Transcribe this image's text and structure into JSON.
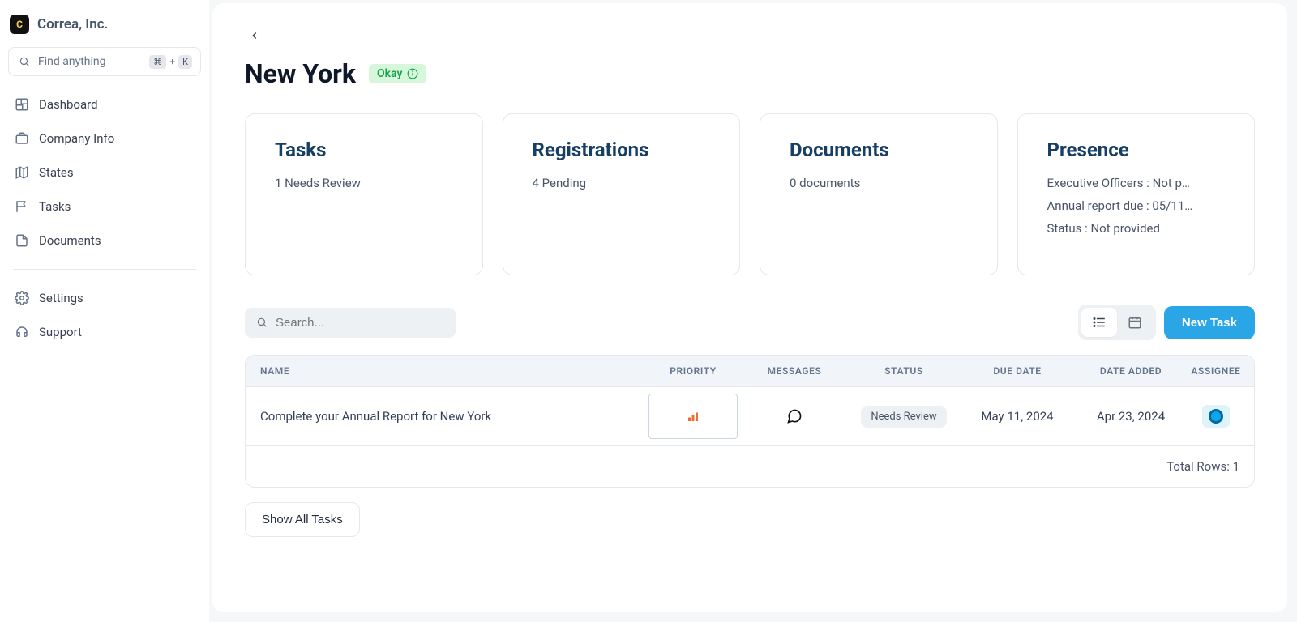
{
  "brand": {
    "name": "Correa, Inc.",
    "logo_letter": "C"
  },
  "search": {
    "placeholder": "Find anything",
    "shortcut_mod": "⌘",
    "shortcut_plus": "+",
    "shortcut_key": "K"
  },
  "nav": {
    "dashboard": "Dashboard",
    "company": "Company Info",
    "states": "States",
    "tasks": "Tasks",
    "documents": "Documents",
    "settings": "Settings",
    "support": "Support"
  },
  "page": {
    "title": "New York",
    "status_badge": "Okay"
  },
  "cards": {
    "tasks": {
      "title": "Tasks",
      "line1": "1 Needs Review"
    },
    "registrations": {
      "title": "Registrations",
      "line1": "4 Pending"
    },
    "documents": {
      "title": "Documents",
      "line1": "0 documents"
    },
    "presence": {
      "title": "Presence",
      "line1": "Executive Officers : Not p…",
      "line2": "Annual report due : 05/11…",
      "line3": "Status : Not provided"
    }
  },
  "table": {
    "search_placeholder": "Search...",
    "new_task_label": "New Task",
    "columns": {
      "name": "NAME",
      "priority": "PRIORITY",
      "messages": "MESSAGES",
      "status": "STATUS",
      "due": "DUE DATE",
      "added": "DATE ADDED",
      "assignee": "ASSIGNEE"
    },
    "rows": [
      {
        "name": "Complete your Annual Report for New York",
        "status": "Needs Review",
        "due": "May 11, 2024",
        "added": "Apr 23, 2024"
      }
    ],
    "footer": "Total Rows: 1",
    "show_all": "Show All Tasks"
  }
}
